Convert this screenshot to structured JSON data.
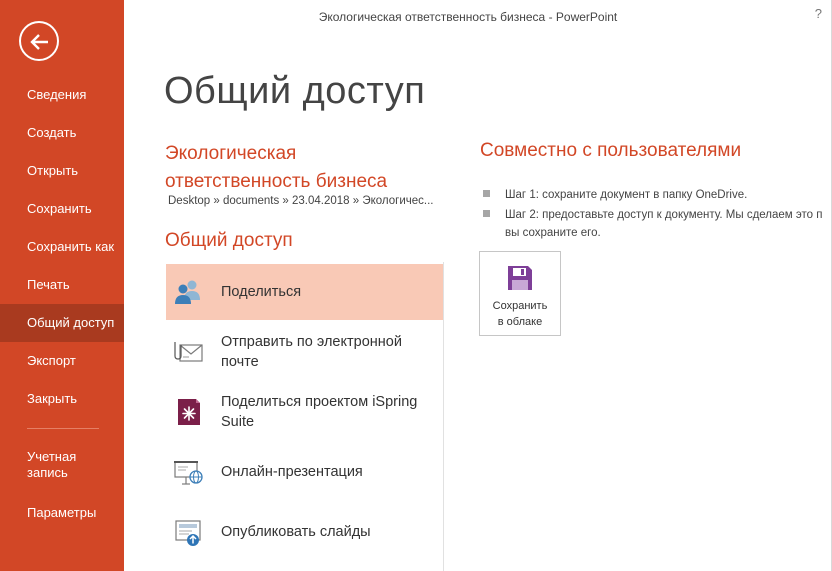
{
  "window": {
    "title": "Экологическая ответственность бизнеса - PowerPoint",
    "help": "?"
  },
  "sidebar": {
    "items": [
      {
        "label": "Сведения"
      },
      {
        "label": "Создать"
      },
      {
        "label": "Открыть"
      },
      {
        "label": "Сохранить"
      },
      {
        "label": "Сохранить как"
      },
      {
        "label": "Печать"
      },
      {
        "label": "Общий доступ",
        "active": true
      },
      {
        "label": "Экспорт"
      },
      {
        "label": "Закрыть"
      }
    ],
    "account_line1": "Учетная",
    "account_line2": "запись",
    "options": "Параметры",
    "accent_color": "#d24726",
    "active_color": "#a93a1f"
  },
  "main": {
    "page_title": "Общий доступ",
    "doc_title_line1": "Экологическая",
    "doc_title_line2": "ответственность бизнеса",
    "doc_path": "Desktop » documents » 23.04.2018 » Экологичес...",
    "section_title": "Общий доступ",
    "options": [
      {
        "label_line1": "Поделиться",
        "label_line2": "",
        "icon": "people-icon",
        "selected": true
      },
      {
        "label_line1": "Отправить по электронной",
        "label_line2": "почте",
        "icon": "email-icon"
      },
      {
        "label_line1": "Поделиться проектом iSpring",
        "label_line2": "Suite",
        "icon": "ispring-icon"
      },
      {
        "label_line1": "Онлайн-презентация",
        "label_line2": "",
        "icon": "presentation-icon"
      },
      {
        "label_line1": "Опубликовать слайды",
        "label_line2": "",
        "icon": "publish-icon"
      }
    ]
  },
  "right_panel": {
    "title": "Совместно с пользователями",
    "step1": "Шаг 1: сохраните документ в папку OneDrive.",
    "step2_line1": "Шаг 2: предоставьте доступ к документу. Мы сделаем это п",
    "step2_line2": "вы сохраните его.",
    "cloud_button_line1": "Сохранить",
    "cloud_button_line2": "в облаке",
    "cloud_icon": "floppy-disk-icon"
  }
}
